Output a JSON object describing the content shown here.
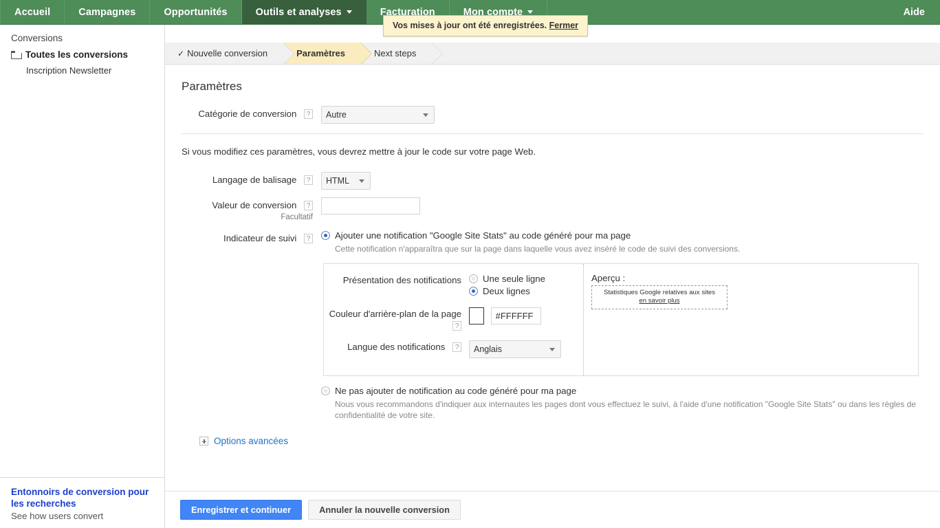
{
  "topnav": {
    "items": [
      {
        "label": "Accueil",
        "active": false,
        "caret": false
      },
      {
        "label": "Campagnes",
        "active": false,
        "caret": false
      },
      {
        "label": "Opportunités",
        "active": false,
        "caret": false
      },
      {
        "label": "Outils et analyses",
        "active": true,
        "caret": true
      },
      {
        "label": "Facturation",
        "active": false,
        "caret": false
      },
      {
        "label": "Mon compte",
        "active": false,
        "caret": true
      }
    ],
    "help_label": "Aide",
    "toast": {
      "message": "Vos mises à jour ont été enregistrées.",
      "close_label": "Fermer"
    }
  },
  "sidebar": {
    "header": "Conversions",
    "selected_item": "Toutes les conversions",
    "sub_item": "Inscription Newsletter",
    "promo_title": "Entonnoirs de conversion pour les recherches",
    "promo_sub": "See how users convert"
  },
  "steps": [
    {
      "label": "Nouvelle conversion",
      "check": "✓",
      "state": "done"
    },
    {
      "label": "Paramètres",
      "check": "",
      "state": "current"
    },
    {
      "label": "Next steps",
      "check": "",
      "state": "todo"
    }
  ],
  "main": {
    "page_title": "Paramètres",
    "category": {
      "label": "Catégorie de conversion",
      "help": "?",
      "value": "Autre",
      "options": [
        "Autre"
      ]
    },
    "intro_text": "Si vous modifiez ces paramètres, vous devrez mettre à jour le code sur votre page Web.",
    "markup": {
      "label": "Langage de balisage",
      "help": "?",
      "value": "HTML",
      "options": [
        "HTML"
      ]
    },
    "conversion_value": {
      "label": "Valeur de conversion",
      "sub_label": "Facultatif",
      "help": "?",
      "value": "",
      "placeholder": ""
    },
    "tracking_indicator": {
      "label": "Indicateur de suivi",
      "help": "?",
      "option_add": {
        "text": "Ajouter une notification \"Google Site Stats\" au code généré pour ma page",
        "selected": true,
        "help_text": "Cette notification n'apparaîtra que sur la page dans laquelle vous avez inséré le code de suivi des conversions."
      },
      "option_none": {
        "text": "Ne pas ajouter de notification au code généré pour ma page",
        "selected": false,
        "help_text": "Nous vous recommandons d'indiquer aux internautes les pages dont vous effectuez le suivi, à l'aide d'une notification \"Google Site Stats\" ou dans les règles de confidentialité de votre site."
      }
    },
    "notification_panel": {
      "presentation": {
        "label": "Présentation des notifications",
        "options": [
          {
            "label": "Une seule ligne",
            "selected": false
          },
          {
            "label": "Deux lignes",
            "selected": true
          }
        ]
      },
      "background_color": {
        "label": "Couleur d'arrière-plan de la page",
        "help": "?",
        "value": "#FFFFFF",
        "swatch_color": "#FFFFFF"
      },
      "language": {
        "label": "Langue des notifications",
        "help": "?",
        "value": "Anglais",
        "options": [
          "Anglais"
        ]
      },
      "preview": {
        "title": "Aperçu :",
        "line1": "Statistiques Google relatives aux sites",
        "line2": "en savoir plus"
      }
    },
    "advanced_options_label": "Options avancées"
  },
  "footer": {
    "save_label": "Enregistrer et continuer",
    "cancel_label": "Annuler la nouvelle conversion"
  },
  "colors": {
    "nav_green": "#4e8c58",
    "nav_active_green": "#38603c",
    "primary_blue": "#4285f4",
    "link_blue": "#1a73c8",
    "step_current": "#fbecbf",
    "toast_bg": "#fdf3cd"
  }
}
